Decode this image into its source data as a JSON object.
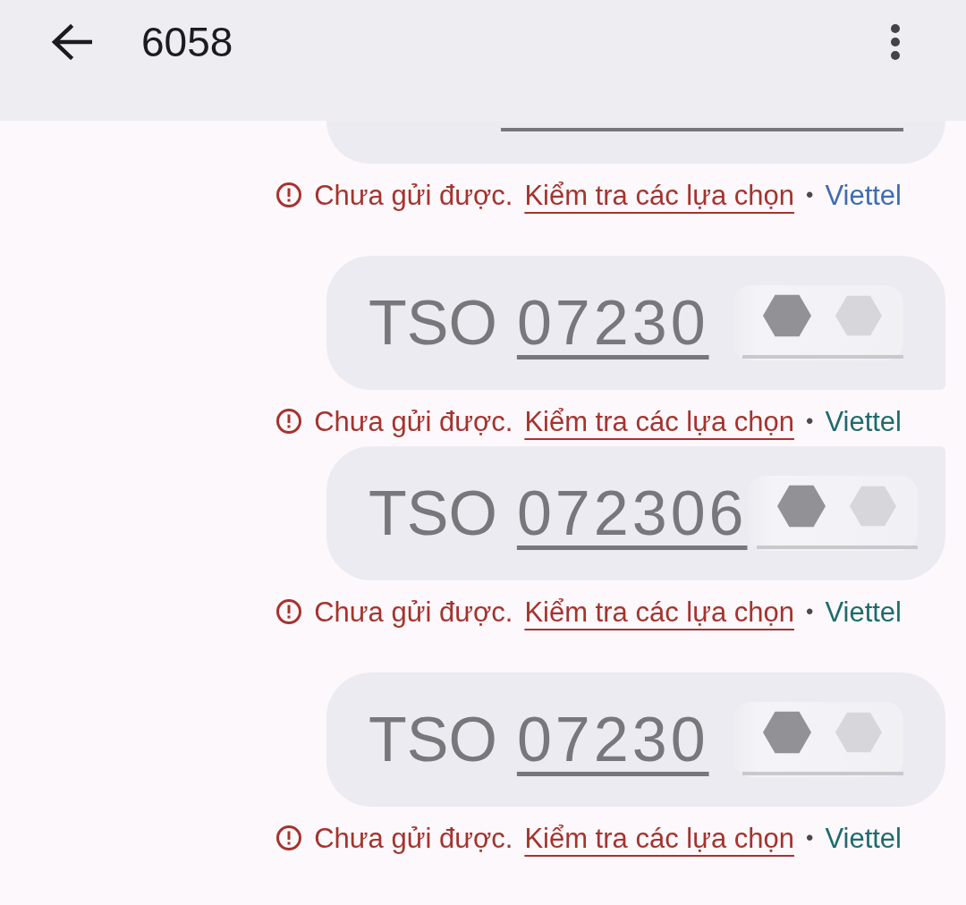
{
  "header": {
    "title": "6058"
  },
  "message_groups": [
    {
      "messages": [
        {
          "kind": "clipped",
          "status": {
            "error": "Chưa gửi được.",
            "action": "Kiểm tra các lựa chọn",
            "separator": "•",
            "carrier": "Viettel",
            "color": "#3d6cb3"
          }
        }
      ]
    },
    {
      "messages": [
        {
          "kind": "full",
          "text": "TSO",
          "number": "07230",
          "redacted": true,
          "status": {
            "error": "Chưa gửi được.",
            "action": "Kiểm tra các lựa chọn",
            "separator": "•",
            "carrier": "Viettel",
            "color": "#1d6b6d"
          }
        },
        {
          "kind": "full",
          "text": "TSO",
          "number": "072306",
          "redacted": true,
          "status": {
            "error": "Chưa gửi được.",
            "action": "Kiểm tra các lựa chọn",
            "separator": "•",
            "carrier": "Viettel",
            "color": "#1d6b6d"
          }
        }
      ]
    },
    {
      "messages": [
        {
          "kind": "full",
          "text": "TSO",
          "number": "07230",
          "redacted": true,
          "status": {
            "error": "Chưa gửi được.",
            "action": "Kiểm tra các lựa chọn",
            "separator": "•",
            "carrier": "Viettel",
            "color": "#1d6b6d"
          }
        }
      ]
    }
  ]
}
